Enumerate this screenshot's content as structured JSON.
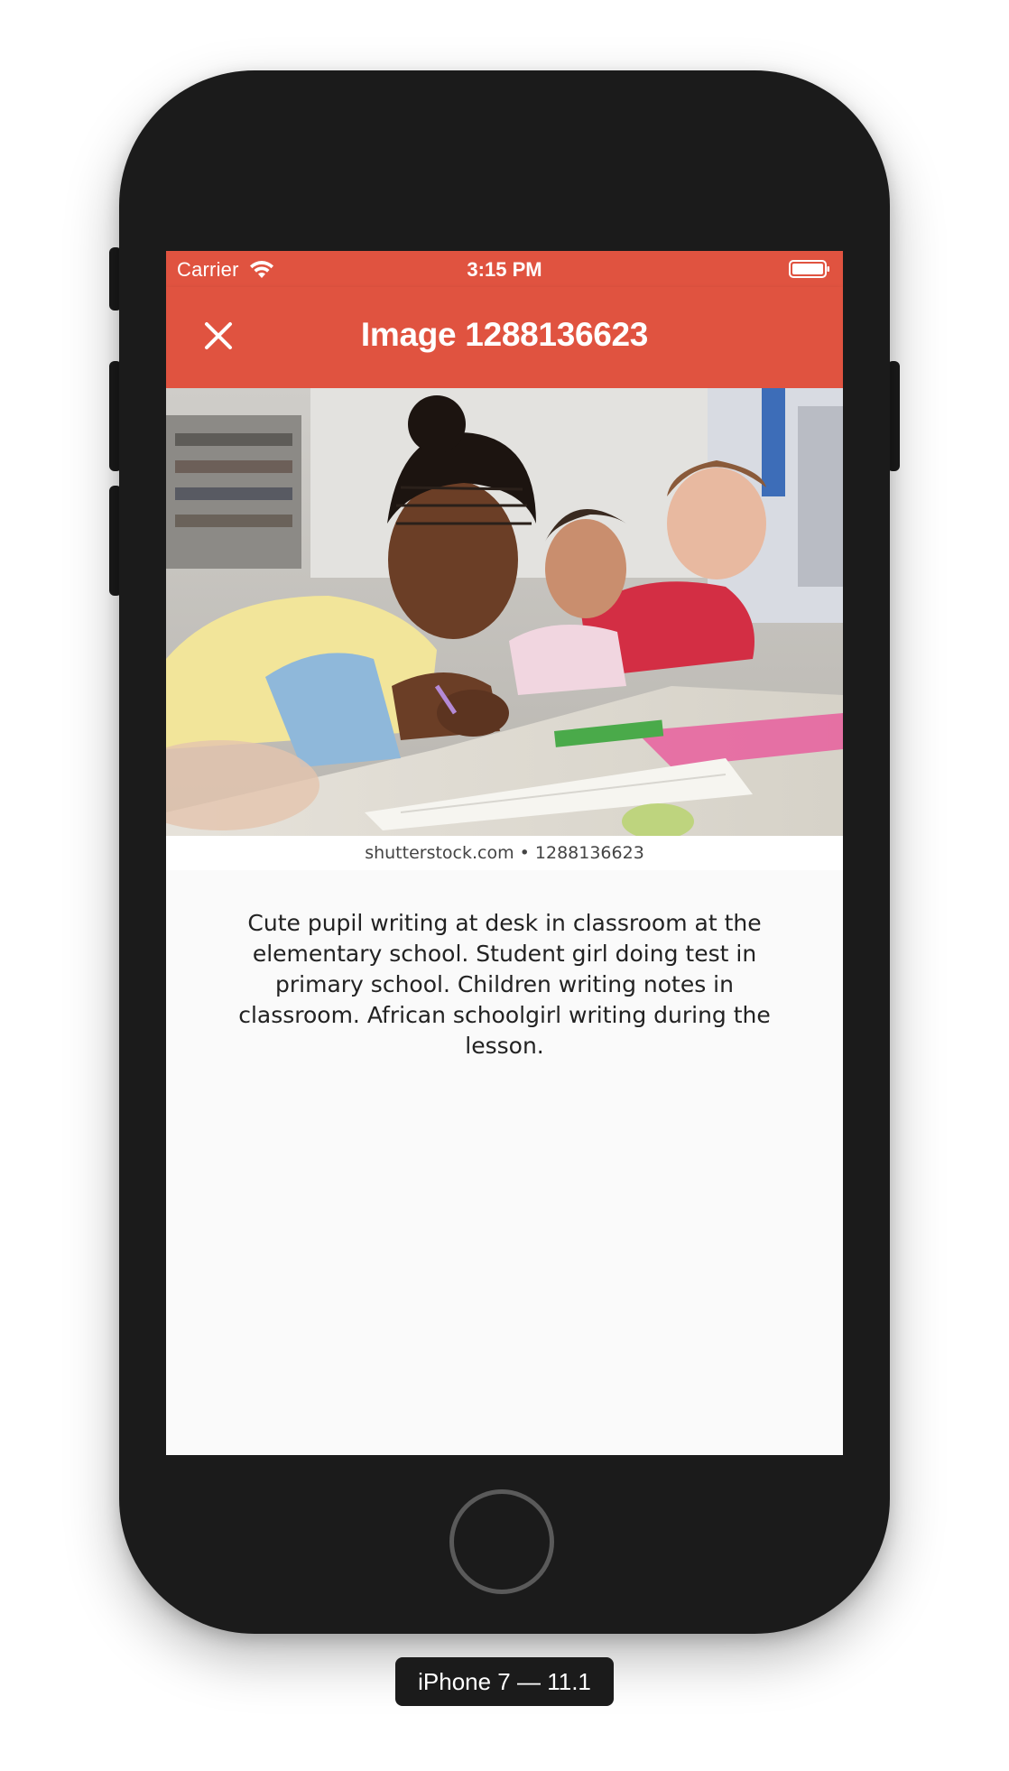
{
  "status_bar": {
    "carrier": "Carrier",
    "time": "3:15 PM",
    "wifi_icon": "wifi-icon",
    "battery_icon": "battery-full-icon"
  },
  "app_bar": {
    "title": "Image 1288136623",
    "close_icon": "close-icon",
    "background_color": "#e05340"
  },
  "image": {
    "watermark": "shutterstock.com • 1288136623"
  },
  "description": "Cute pupil writing at desk in classroom at the elementary school. Student girl doing test in primary school. Children writing notes in classroom. African schoolgirl writing during the lesson.",
  "device_label": "iPhone 7 — 11.1"
}
